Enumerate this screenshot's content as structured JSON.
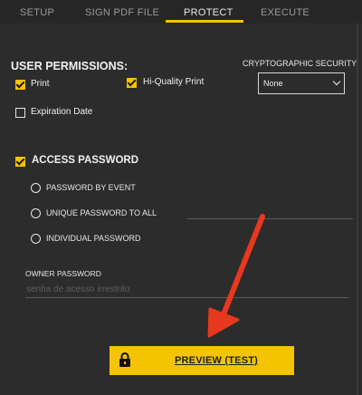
{
  "tabs": [
    {
      "label": "SETUP"
    },
    {
      "label": "SIGN PDF FILE"
    },
    {
      "label": "PROTECT"
    },
    {
      "label": "EXECUTE"
    }
  ],
  "active_tab": "PROTECT",
  "user_permissions": {
    "title": "USER PERMISSIONS:",
    "print_label": "Print",
    "print_checked": true,
    "hiquality_label": "Hi-Quality Print",
    "hiquality_checked": true,
    "expiration_label": "Expiration Date",
    "expiration_checked": false
  },
  "crypto": {
    "label": "CRYPTOGRAPHIC SECURITY",
    "value": "None"
  },
  "access_password": {
    "title": "ACCESS PASSWORD",
    "checked": true,
    "options": [
      {
        "label": "PASSWORD BY EVENT",
        "selected": false
      },
      {
        "label": "UNIQUE PASSWORD TO ALL",
        "selected": false
      },
      {
        "label": "INDIVIDUAL PASSWORD",
        "selected": false
      }
    ]
  },
  "owner_password": {
    "label": "OWNER PASSWORD",
    "placeholder": "senha de acesso irrestrito"
  },
  "preview_button": {
    "label": "PREVIEW (TEST)",
    "icon": "lock-icon"
  },
  "colors": {
    "accent": "#f5c400",
    "background": "#2c2c2c",
    "annotation_arrow": "#e8381f"
  }
}
